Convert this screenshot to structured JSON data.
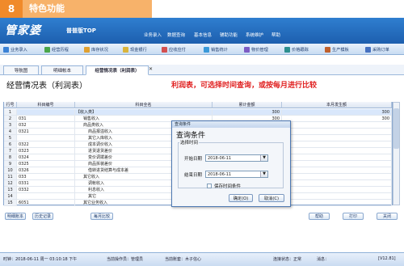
{
  "promo": {
    "number": "8",
    "title": "特色功能"
  },
  "app": {
    "logo": "管家婆",
    "edition": "普普版TOP"
  },
  "top_menu": [
    "业务录入",
    "数据查询",
    "基本信息",
    "辅助功能",
    "系统维护",
    "帮助"
  ],
  "toolbar": [
    "业务录入",
    "经营历程",
    "库存状况",
    "现金银行",
    "应收应付",
    "销售统计",
    "物价管理",
    "价格跟踪",
    "生产模板",
    "采购订单"
  ],
  "tabs": {
    "nav": "导航图",
    "detail": "明细帐本",
    "report": "经营情况表（利润表）",
    "close": "✕"
  },
  "report": {
    "title": "经营情况表（利润表）",
    "description": "利润表，可选择时间查询，或按每月进行比较"
  },
  "table": {
    "headers": [
      "行号",
      "科目编号",
      "科目全名",
      "累计金额",
      "本月发生额"
    ],
    "rows": [
      {
        "n": "1",
        "code": "",
        "name": "【收入类】",
        "total": "300",
        "month": "300"
      },
      {
        "n": "2",
        "code": "031",
        "name": "销售收入",
        "total": "300",
        "month": "300"
      },
      {
        "n": "3",
        "code": "032",
        "name": "商品类收入",
        "total": "",
        "month": ""
      },
      {
        "n": "4",
        "code": "0321",
        "name": "商品报溢收入",
        "total": "",
        "month": ""
      },
      {
        "n": "5",
        "code": "",
        "name": "其它入库收入",
        "total": "",
        "month": ""
      },
      {
        "n": "6",
        "code": "0322",
        "name": "成本调价收入",
        "total": "",
        "month": ""
      },
      {
        "n": "7",
        "code": "0323",
        "name": "进货退货差价",
        "total": "",
        "month": ""
      },
      {
        "n": "8",
        "code": "0324",
        "name": "变价调拨差价",
        "total": "",
        "month": ""
      },
      {
        "n": "9",
        "code": "0325",
        "name": "商品拆装差价",
        "total": "",
        "month": ""
      },
      {
        "n": "10",
        "code": "0326",
        "name": "借转进货结算与成本差",
        "total": "",
        "month": ""
      },
      {
        "n": "11",
        "code": "033",
        "name": "其它收入",
        "total": "",
        "month": ""
      },
      {
        "n": "12",
        "code": "0331",
        "name": "调帐收入",
        "total": "",
        "month": ""
      },
      {
        "n": "13",
        "code": "0332",
        "name": "利息收入",
        "total": "",
        "month": ""
      },
      {
        "n": "14",
        "code": "",
        "name": "其它",
        "total": "",
        "month": ""
      },
      {
        "n": "15",
        "code": "6051",
        "name": "其它业务收入",
        "total": "",
        "month": ""
      }
    ]
  },
  "buttons": {
    "detail": "明细账本",
    "history": "历史记录",
    "monthly": "每月比较",
    "help": "帮助",
    "print": "打印",
    "close": "关闭"
  },
  "status": {
    "time": "时钟：2018-06-11 周一 03:10:18 下午",
    "operator": "当前操作员：管理员",
    "account": "当前账套：木子信心",
    "speed": "连接状态：正常",
    "message": "消息：",
    "version": "[V12.81]"
  },
  "dialog": {
    "titlebar": "查询条件",
    "heading": "查询条件",
    "group": "选择时间",
    "start_label": "开始日期",
    "start_value": "2018-06-11",
    "end_label": "结束日期",
    "end_value": "2018-06-11",
    "save_label": "保存时间条件",
    "ok": "确定(O)",
    "cancel": "取消(C)"
  }
}
